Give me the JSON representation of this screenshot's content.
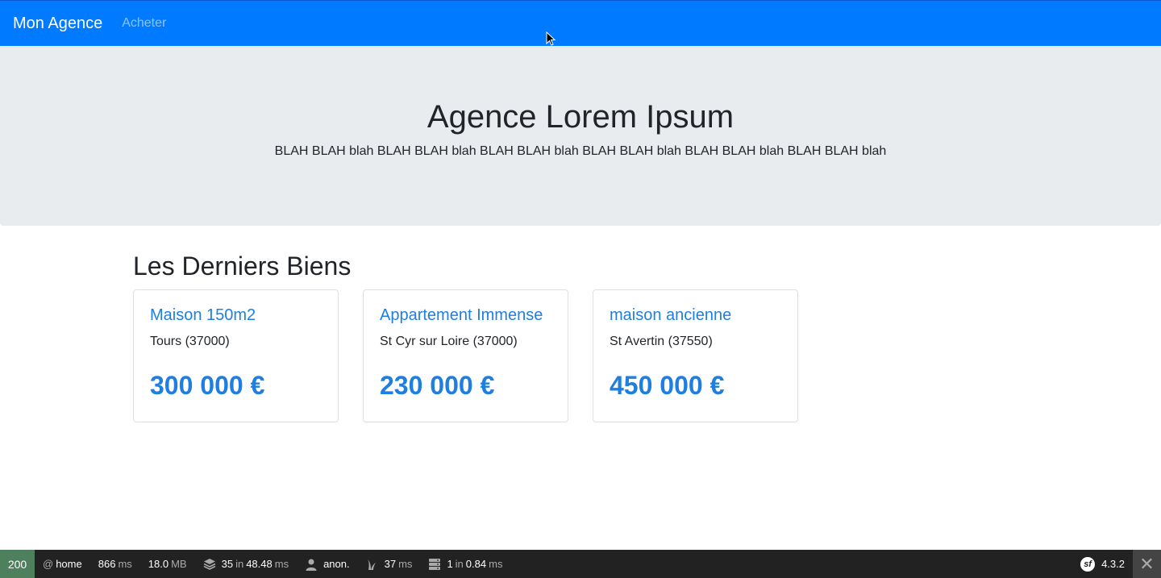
{
  "nav": {
    "brand": "Mon Agence",
    "link_buy": "Acheter"
  },
  "hero": {
    "title": "Agence Lorem Ipsum",
    "text": "BLAH BLAH blah BLAH BLAH blah BLAH BLAH blah BLAH BLAH blah BLAH BLAH blah BLAH BLAH blah"
  },
  "section": {
    "title": "Les Derniers Biens"
  },
  "properties": [
    {
      "title": "Maison 150m2",
      "location": "Tours (37000)",
      "price": "300 000 €"
    },
    {
      "title": "Appartement Immense",
      "location": "St Cyr sur Loire (37000)",
      "price": "230 000 €"
    },
    {
      "title": "maison ancienne",
      "location": "St Avertin (37550)",
      "price": "450 000 €"
    }
  ],
  "toolbar": {
    "status": "200",
    "route_prefix": "@",
    "route": "home",
    "time_value": "866",
    "time_unit": "ms",
    "memory_value": "18.0",
    "memory_unit": "MB",
    "queries_count": "35",
    "queries_in": "in",
    "queries_time": "48.48",
    "queries_unit": "ms",
    "user": "anon.",
    "twig_time": "37",
    "twig_unit": "ms",
    "cache_count": "1",
    "cache_in": "in",
    "cache_time": "0.84",
    "cache_unit": "ms",
    "version": "4.3.2",
    "sf_logo": "sf"
  },
  "colors": {
    "navbar": "#007bff",
    "accent": "#1e7fe0",
    "jumbotron": "#e9ecef",
    "toolbar": "#222222",
    "status_ok": "#4f805d"
  }
}
